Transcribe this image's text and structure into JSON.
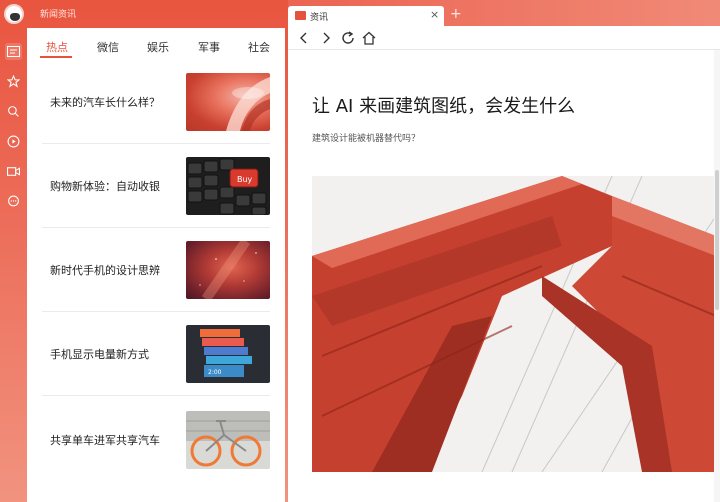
{
  "app": {
    "title": "新闻资讯"
  },
  "sidebar": {
    "icons": [
      {
        "name": "news-icon",
        "active": true
      },
      {
        "name": "star-icon"
      },
      {
        "name": "search-icon"
      },
      {
        "name": "play-icon"
      },
      {
        "name": "video-icon"
      },
      {
        "name": "chat-icon"
      }
    ]
  },
  "tabs": [
    "热点",
    "微信",
    "娱乐",
    "军事",
    "社会"
  ],
  "active_tab": "热点",
  "news": [
    {
      "title": "未来的汽车长什么样？",
      "thumb": "car-light"
    },
    {
      "title": "购物新体验：自动收银",
      "thumb": "keyboard-buy"
    },
    {
      "title": "新时代手机的设计思辨",
      "thumb": "red-galaxy"
    },
    {
      "title": "手机显示电量新方式",
      "thumb": "phone-stack"
    },
    {
      "title": "共享单车进军共享汽车",
      "thumb": "bike"
    }
  ],
  "browser": {
    "tab_label": "资讯",
    "article_title": "让 AI 来画建筑图纸，会发生什么",
    "article_subtitle": "建筑设计能被机器替代吗？"
  },
  "colors": {
    "accent": "#e5533f"
  }
}
